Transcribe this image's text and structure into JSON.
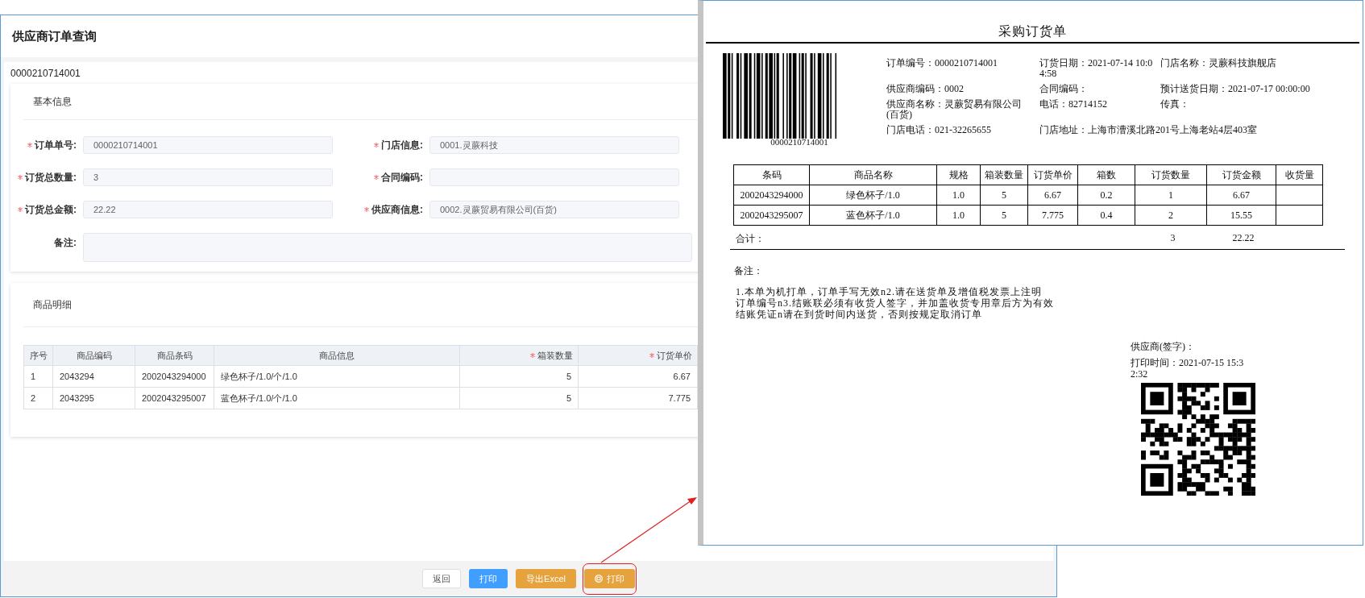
{
  "window": {
    "title": "供应商订单查询"
  },
  "order_number": "0000210714001",
  "basic_info": {
    "title": "基本信息",
    "fields": [
      {
        "label": "订单单号:",
        "required": true,
        "value": "0000210714001"
      },
      {
        "label": "门店信息:",
        "required": true,
        "value": "0001.灵蕨科技"
      },
      {
        "label": "订货总数量:",
        "required": true,
        "value": "3"
      },
      {
        "label": "合同编码:",
        "required": true
      },
      {
        "label": "订货总金额:",
        "required": true,
        "value": "22.22"
      },
      {
        "label": "供应商信息:",
        "required": true,
        "value": "0002.灵蕨贸易有限公司(百货)"
      }
    ],
    "remark": {
      "label": "备注:"
    }
  },
  "details": {
    "title": "商品明细",
    "columns": [
      {
        "label": "序号",
        "required": false
      },
      {
        "label": "商品编码",
        "required": false
      },
      {
        "label": "商品条码",
        "required": false
      },
      {
        "label": "商品信息",
        "required": false
      },
      {
        "label": "箱装数量",
        "required": true
      },
      {
        "label": "订货单价",
        "required": true
      }
    ],
    "rows": [
      [
        "1",
        "2043294",
        "2002043294000",
        "绿色杯子/1.0/个/1.0",
        "5",
        "6.67"
      ],
      [
        "2",
        "2043295",
        "2002043295007",
        "蓝色杯子/1.0/个/1.0",
        "5",
        "7.775"
      ]
    ]
  },
  "buttons": [
    {
      "label": "返回",
      "kind": "plain",
      "with_icon": false,
      "highlighted": false
    },
    {
      "label": "打印",
      "kind": "primary",
      "with_icon": false,
      "highlighted": false
    },
    {
      "label": "导出Excel",
      "kind": "warning",
      "with_icon": false,
      "highlighted": false
    },
    {
      "label": "打印",
      "kind": "warning",
      "with_icon": true,
      "highlighted": true
    }
  ],
  "print_preview": {
    "title": "采购订货单",
    "barcode_text": "0000210714001",
    "info": [
      [
        "订单编号：0000210714001",
        "订货日期：2021-07-14 10:04:58",
        "门店名称：灵蕨科技旗舰店"
      ],
      [
        "供应商编码：0002",
        "合同编码：",
        "预计送货日期：2021-07-17 00:00:00"
      ],
      [
        "供应商名称：灵蕨贸易有限公司(百货)",
        "电话：82714152",
        "传真："
      ],
      [
        "门店电话：021-32265655",
        "门店地址：上海市漕溪北路201号上海老站4层403室"
      ]
    ],
    "columns": [
      "条码",
      "商品名称",
      "规格",
      "箱装数量",
      "订货单价",
      "箱数",
      "订货数量",
      "订货金额",
      "收货量"
    ],
    "rows": [
      [
        "2002043294000",
        "绿色杯子/1.0",
        "1.0",
        "5",
        "6.67",
        "0.2",
        "1",
        "6.67"
      ],
      [
        "2002043295007",
        "蓝色杯子/1.0",
        "1.0",
        "5",
        "7.775",
        "0.4",
        "2",
        "15.55"
      ]
    ],
    "total": {
      "label": "合计：",
      "quantity": "3",
      "amount": "22.22"
    },
    "remark_label": "备注：",
    "notes": [
      "1.本单为机打单，订单手写无效n2.请在送货单及增值税发票上注明",
      "订单编号n3.结账联必须有收货人签字，并加盖收货专用章后方为有效",
      "结账凭证n请在到货时间内送货，否则按规定取消订单"
    ],
    "signature": "供应商(签字)：",
    "print_time": "打印时间：2021-07-15 15:32:32"
  }
}
